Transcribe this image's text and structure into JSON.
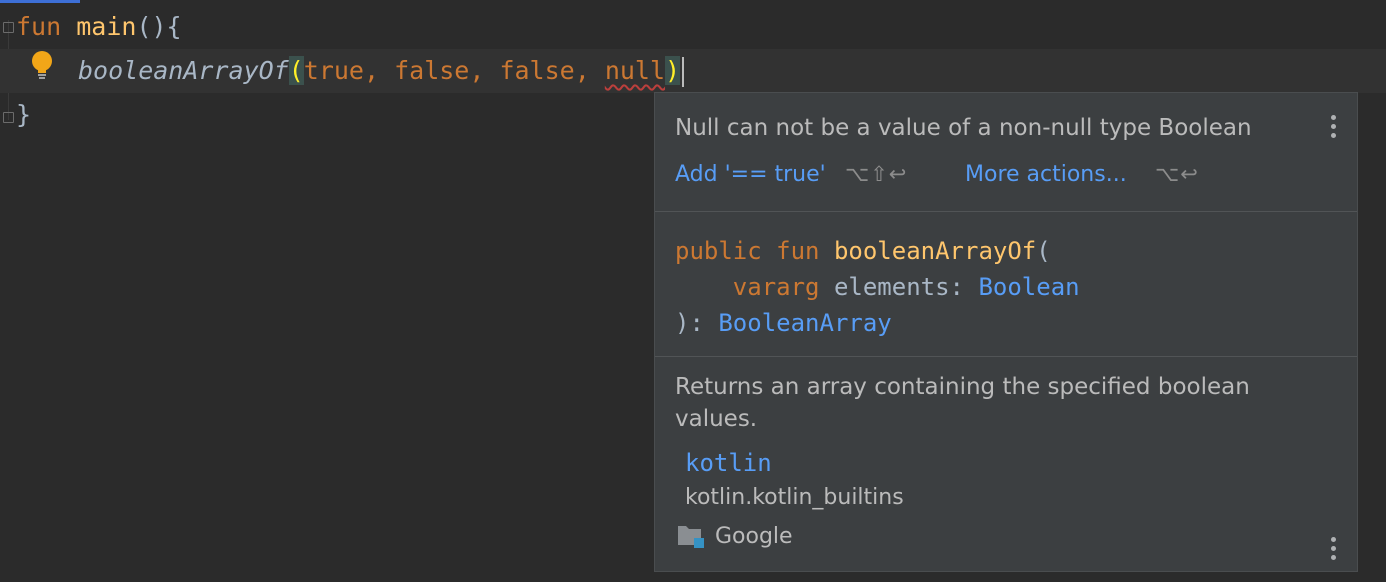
{
  "editor": {
    "line1": {
      "kw": "fun",
      "name": "main",
      "rest": "(){"
    },
    "line2": {
      "fn": "booleanArrayOf",
      "open": "(",
      "args": "true, false, false, ",
      "bad_arg": "null",
      "close": ")"
    },
    "line3": {
      "brace": "}"
    }
  },
  "popup": {
    "message": "Null can not be a value of a non-null type Boolean",
    "action1_label": "Add '== true'",
    "action1_shortcut": "⌥⇧↩",
    "action2_label": "More actions...",
    "action2_shortcut": "⌥↩",
    "signature": {
      "line1_kw": "public fun ",
      "line1_fn": "booleanArrayOf",
      "line1_paren": "(",
      "line2_kw": "vararg",
      "line2_param": " elements: ",
      "line2_type": "Boolean",
      "line3_prefix": "): ",
      "line3_type": "BooleanArray"
    },
    "description": "Returns an array containing the specified boolean values.",
    "package_link": "kotlin",
    "package_full": "kotlin.kotlin_builtins",
    "library": "Google"
  },
  "colors": {
    "keyword": "#cc7832",
    "function": "#ffc66d",
    "link": "#589df6",
    "error": "#bc3f3c"
  }
}
